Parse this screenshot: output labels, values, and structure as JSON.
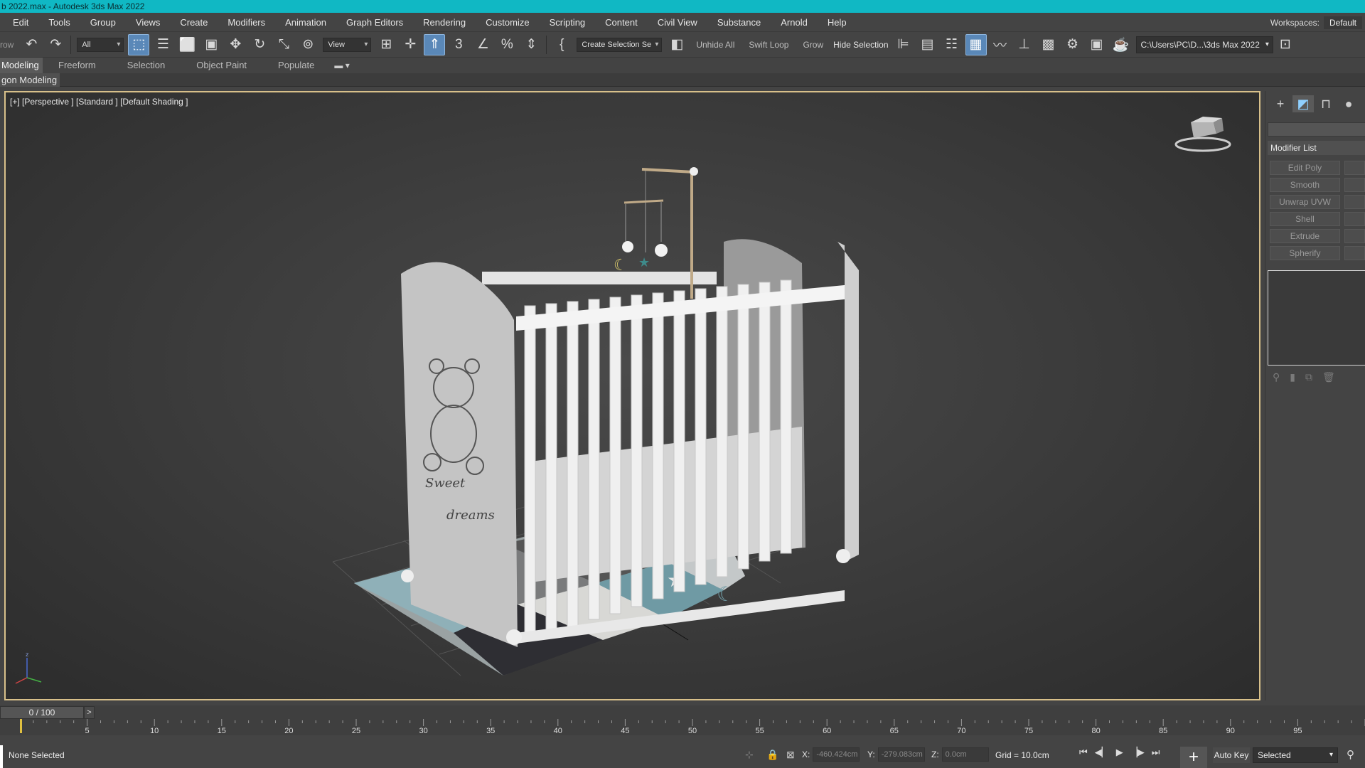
{
  "window": {
    "title": "b 2022.max - Autodesk 3ds Max 2022"
  },
  "menu": {
    "items": [
      "Edit",
      "Tools",
      "Group",
      "Views",
      "Create",
      "Modifiers",
      "Animation",
      "Graph Editors",
      "Rendering",
      "Customize",
      "Scripting",
      "Content",
      "Civil View",
      "Substance",
      "Arnold",
      "Help"
    ],
    "workspaces_label": "Workspaces:",
    "workspaces_value": "Default"
  },
  "toolbar": {
    "left_text": "row",
    "selection_filter": "All",
    "ref_coord": "View",
    "named_selection": "Create Selection Se",
    "unhide_all": "Unhide All",
    "swift_loop": "Swift Loop",
    "grow": "Grow",
    "hide_selection": "Hide Selection",
    "project_path": "C:\\Users\\PC\\D...\\3ds Max 2022"
  },
  "ribbon": {
    "tabs": [
      "Modeling",
      "Freeform",
      "Selection",
      "Object Paint",
      "Populate"
    ],
    "active_tab": "Modeling",
    "sub_label": "gon Modeling"
  },
  "viewport": {
    "label": "[+] [Perspective ] [Standard ] [Default Shading ]",
    "model_text_1": "Sweet",
    "model_text_2": "dreams"
  },
  "command_panel": {
    "modifier_list_label": "Modifier List",
    "modifier_buttons": [
      "Edit Poly",
      "Smooth",
      "Unwrap UVW",
      "Shell",
      "Extrude",
      "Spherify"
    ]
  },
  "timeline": {
    "frame_display": "0 / 100",
    "next_label": ">",
    "ticks": [
      "5",
      "10",
      "15",
      "20",
      "25",
      "30",
      "35",
      "40",
      "45",
      "50",
      "55",
      "60",
      "65",
      "70",
      "75",
      "80",
      "85",
      "90",
      "95"
    ],
    "current_frame": 0,
    "total_frames": 100
  },
  "status": {
    "selection_text": "None Selected",
    "x_label": "X:",
    "x_value": "-460.424cm",
    "y_label": "Y:",
    "y_value": "-279.083cm",
    "z_label": "Z:",
    "z_value": "0.0cm",
    "grid": "Grid = 10.0cm",
    "auto_key": "Auto Key",
    "key_filter": "Selected"
  },
  "colors": {
    "title_bar": "#10b8c4",
    "viewport_border": "#d8c08a",
    "active_button": "#5a88b8"
  }
}
